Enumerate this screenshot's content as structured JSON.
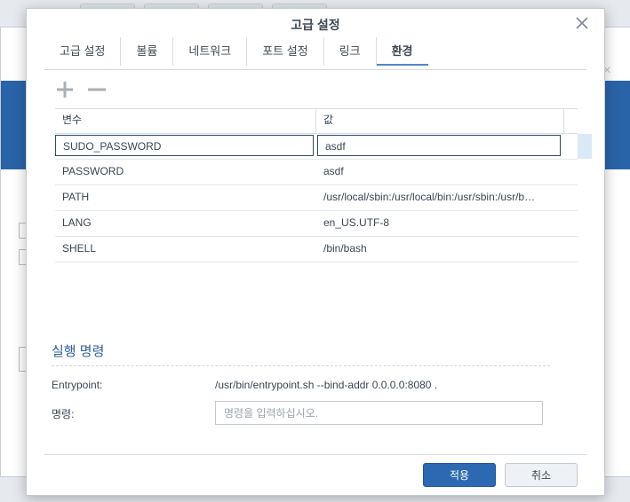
{
  "dialog": {
    "title": "고급 설정",
    "tabs": [
      "고급 설정",
      "볼륨",
      "네트워크",
      "포트 설정",
      "링크",
      "환경"
    ],
    "active_tab": "환경"
  },
  "env_table": {
    "headers": {
      "variable": "변수",
      "value": "값"
    },
    "editing_row": {
      "variable": "SUDO_PASSWORD",
      "value": "asdf"
    },
    "rows": [
      {
        "variable": "PASSWORD",
        "value": "asdf"
      },
      {
        "variable": "PATH",
        "value": "/usr/local/sbin:/usr/local/bin:/usr/sbin:/usr/bin:/sbin:/bin"
      },
      {
        "variable": "LANG",
        "value": "en_US.UTF-8"
      },
      {
        "variable": "SHELL",
        "value": "/bin/bash"
      }
    ]
  },
  "exec": {
    "section_title": "실행 명령",
    "entrypoint_label": "Entrypoint:",
    "entrypoint_value": "/usr/bin/entrypoint.sh --bind-addr 0.0.0.0:8080 .",
    "command_label": "명령:",
    "command_placeholder": "명령을 입력하십시오."
  },
  "buttons": {
    "apply": "적용",
    "cancel": "취소"
  },
  "colors": {
    "accent": "#2d69b2",
    "section_title": "#2f5f99",
    "banner": "#2a64a8"
  }
}
